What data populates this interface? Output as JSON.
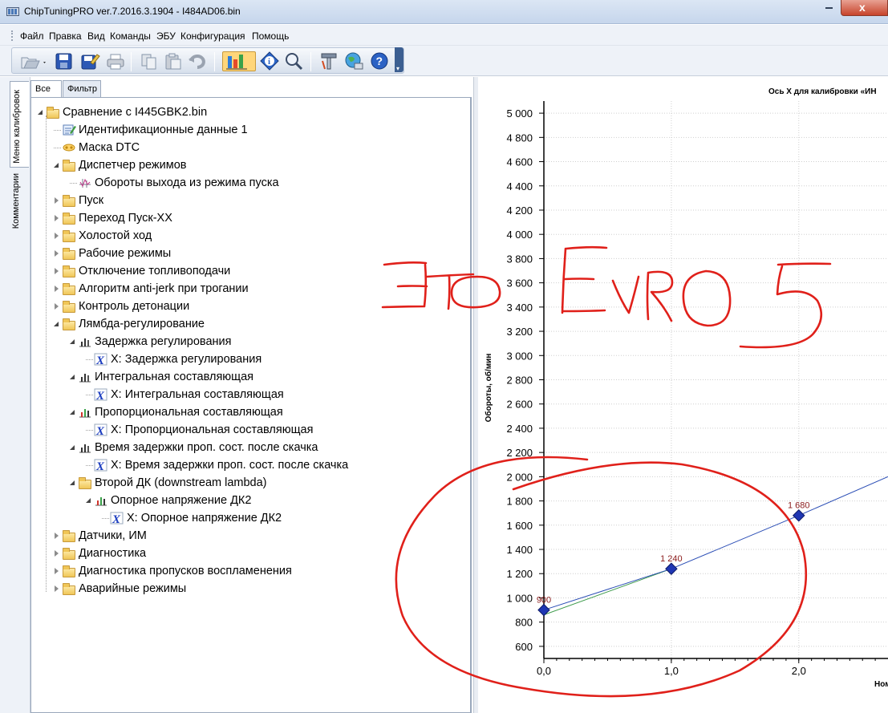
{
  "window": {
    "title": "ChipTuningPRO ver.7.2016.3.1904 - I484AD06.bin",
    "close_glyph": "x"
  },
  "menu": [
    "Файл",
    "Правка",
    "Вид",
    "Команды",
    "ЭБУ",
    "Конфигурация",
    "Помощь"
  ],
  "toolbar": {
    "buttons": [
      "open-icon",
      "save-icon",
      "save-as-icon",
      "print-icon",
      "copy-icon",
      "paste-icon",
      "undo-icon",
      "chart-icon",
      "info-icon",
      "zoom-icon",
      "tools-icon",
      "web-icon",
      "help-icon"
    ],
    "overflow_glyph": "▾"
  },
  "side_tabs": {
    "menu": "Меню калибровок",
    "comments": "Комментарии"
  },
  "tree_tabs": {
    "all": "Все",
    "filter": "Фильтр"
  },
  "tree": [
    {
      "label": "Сравнение с I445GBK2.bin",
      "icon": "folder-icon"
    },
    {
      "label": "Идентификационные данные 1",
      "icon": "id-data-icon"
    },
    {
      "label": "Маска DTC",
      "icon": "dtc-mask-icon"
    },
    {
      "label": "Диспетчер режимов",
      "icon": "folder-icon"
    },
    {
      "label": "Обороты выхода из режима пуска",
      "icon": "constant-icon"
    },
    {
      "label": "Пуск",
      "icon": "folder-icon"
    },
    {
      "label": "Переход Пуск-ХХ",
      "icon": "folder-icon"
    },
    {
      "label": "Холостой ход",
      "icon": "folder-icon"
    },
    {
      "label": "Рабочие режимы",
      "icon": "folder-icon"
    },
    {
      "label": "Отключение топливоподачи",
      "icon": "folder-icon"
    },
    {
      "label": "Алгоритм anti-jerk при трогании",
      "icon": "folder-icon"
    },
    {
      "label": "Контроль детонации",
      "icon": "folder-icon"
    },
    {
      "label": "Лямбда-регулирование",
      "icon": "folder-icon"
    },
    {
      "label": "Задержка регулирования",
      "icon": "curve-icon"
    },
    {
      "label": "X: Задержка регулирования",
      "icon": "axis-x-icon"
    },
    {
      "label": "Интегральная составляющая",
      "icon": "curve-icon"
    },
    {
      "label": "X: Интегральная составляющая",
      "icon": "axis-x-icon"
    },
    {
      "label": "Пропорциональная составляющая",
      "icon": "curve-modified-icon"
    },
    {
      "label": "X: Пропорциональная составляющая",
      "icon": "axis-x-icon"
    },
    {
      "label": "Время задержки проп. сост. после скачка",
      "icon": "curve-icon"
    },
    {
      "label": "X: Время задержки проп. сост. после скачка",
      "icon": "axis-x-icon"
    },
    {
      "label": "Второй ДК (downstream lambda)",
      "icon": "folder-icon"
    },
    {
      "label": "Опорное напряжение ДК2",
      "icon": "curve-modified-icon"
    },
    {
      "label": "X: Опорное напряжение ДК2",
      "icon": "axis-x-icon"
    },
    {
      "label": "Датчики, ИМ",
      "icon": "folder-icon"
    },
    {
      "label": "Диагностика",
      "icon": "folder-icon"
    },
    {
      "label": "Диагностика пропусков воспламенения",
      "icon": "folder-icon"
    },
    {
      "label": "Аварийные режимы",
      "icon": "folder-icon"
    }
  ],
  "chart_data": {
    "type": "line",
    "title": "Ось X для калибровки «ИН",
    "ylabel": "Обороты, об/мин",
    "xlabel": "Ном",
    "ylim": [
      500,
      5100
    ],
    "xlim": [
      0,
      2.7
    ],
    "yticks": [
      "5 000",
      "4 800",
      "4 600",
      "4 400",
      "4 200",
      "4 000",
      "3 800",
      "3 600",
      "3 400",
      "3 200",
      "3 000",
      "2 800",
      "2 600",
      "2 400",
      "2 200",
      "2 000",
      "1 800",
      "1 600",
      "1 400",
      "1 200",
      "1 000",
      "800",
      "600"
    ],
    "ytick_values": [
      5000,
      4800,
      4600,
      4400,
      4200,
      4000,
      3800,
      3600,
      3400,
      3200,
      3000,
      2800,
      2600,
      2400,
      2200,
      2000,
      1800,
      1600,
      1400,
      1200,
      1000,
      800,
      600
    ],
    "xticks": [
      "0,0",
      "1,0",
      "2,0"
    ],
    "xtick_values": [
      0,
      1,
      2
    ],
    "grid": true,
    "series": [
      {
        "x": [
          0,
          1,
          2,
          2.7
        ],
        "y": [
          900,
          1240,
          1680,
          2000
        ],
        "labels": [
          "900",
          "1 240",
          "1 680"
        ],
        "color": "#2a4db5"
      },
      {
        "x": [
          0,
          1
        ],
        "y": [
          860,
          1240
        ],
        "color": "#3c9a4a"
      }
    ]
  },
  "annotation": {
    "text": "ЭТО EVRO 5",
    "color": "#e0201a"
  }
}
